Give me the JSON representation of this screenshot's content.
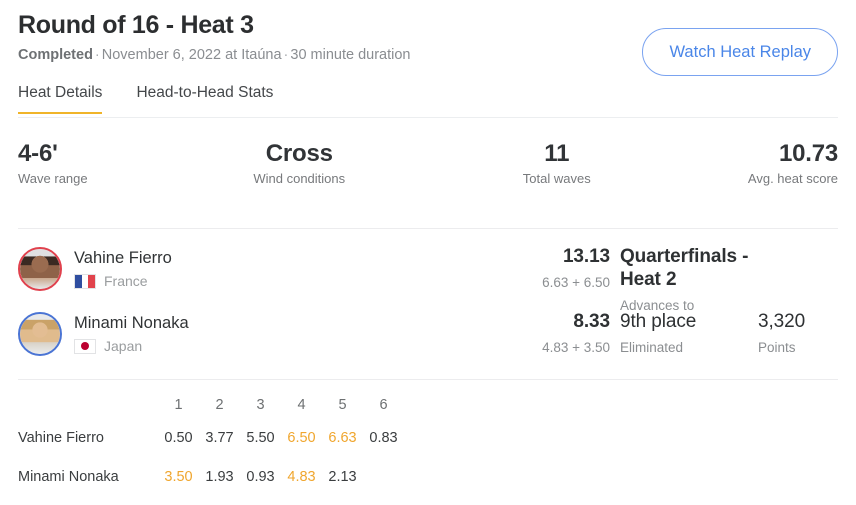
{
  "header": {
    "title": "Round of 16 - Heat 3",
    "status": "Completed",
    "date": "November 6, 2022 at Itaúna",
    "duration": "30 minute duration",
    "separator": "·",
    "replay_button": "Watch Heat Replay"
  },
  "tabs": [
    {
      "label": "Heat Details",
      "active": true
    },
    {
      "label": "Head-to-Head Stats",
      "active": false
    }
  ],
  "stats": [
    {
      "value": "4-6'",
      "label": "Wave range"
    },
    {
      "value": "Cross",
      "label": "Wind conditions"
    },
    {
      "value": "11",
      "label": "Total waves"
    },
    {
      "value": "10.73",
      "label": "Avg. heat score"
    }
  ],
  "athletes": [
    {
      "name": "Vahine Fierro",
      "country": "France",
      "flag": "france-flag-icon",
      "jersey_color": "#e0414d",
      "total": "13.13",
      "breakdown": "6.63 + 6.50",
      "result": "Quarterfinals - Heat 2",
      "result_caption": "Advances to",
      "points": "",
      "points_caption": ""
    },
    {
      "name": "Minami Nonaka",
      "country": "Japan",
      "flag": "japan-flag-icon",
      "jersey_color": "#4a74d4",
      "total": "8.33",
      "breakdown": "4.83 + 3.50",
      "result": "9th place",
      "result_caption": "Eliminated",
      "points": "3,320",
      "points_caption": "Points"
    }
  ],
  "wave_table": {
    "columns": [
      "1",
      "2",
      "3",
      "4",
      "5",
      "6"
    ],
    "rows": [
      {
        "name": "Vahine Fierro",
        "scores": [
          {
            "value": "0.50",
            "counted": false
          },
          {
            "value": "3.77",
            "counted": false
          },
          {
            "value": "5.50",
            "counted": false
          },
          {
            "value": "6.50",
            "counted": true
          },
          {
            "value": "6.63",
            "counted": true
          },
          {
            "value": "0.83",
            "counted": false
          }
        ]
      },
      {
        "name": "Minami Nonaka",
        "scores": [
          {
            "value": "3.50",
            "counted": true
          },
          {
            "value": "1.93",
            "counted": false
          },
          {
            "value": "0.93",
            "counted": false
          },
          {
            "value": "4.83",
            "counted": true
          },
          {
            "value": "2.13",
            "counted": false
          },
          {
            "value": "",
            "counted": false
          }
        ]
      }
    ]
  },
  "colors": {
    "accent_orange": "#f0a62e",
    "link_blue": "#4a86e8",
    "text_primary": "#2f3133",
    "text_muted": "#8a8d91"
  }
}
